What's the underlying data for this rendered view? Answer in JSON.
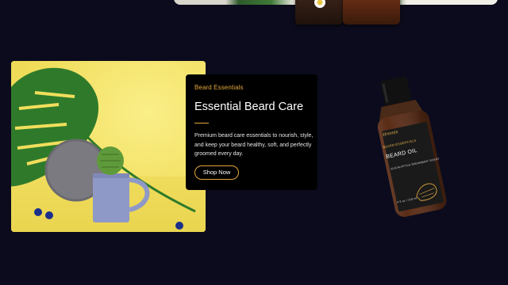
{
  "promo": {
    "eyebrow": "Beard Essentials",
    "heading": "Essential Beard Care",
    "description": "Premium beard care essentials to nourish, style, and keep your beard healthy, soft, and perfectly groomed every day.",
    "cta_label": "Shop Now"
  },
  "bottle": {
    "brand": "Hmmis",
    "line": "BEARD ESSENTIALS",
    "title": "BEARD OIL",
    "scent": "EUCALYPTUS SPEARMINT SCENT",
    "volume": "4 fl oz / 118 ml"
  },
  "colors": {
    "page_background": "#0b0b1d",
    "card_background": "#000000",
    "accent": "#e2a63b",
    "image_background": "#f3e26a"
  }
}
